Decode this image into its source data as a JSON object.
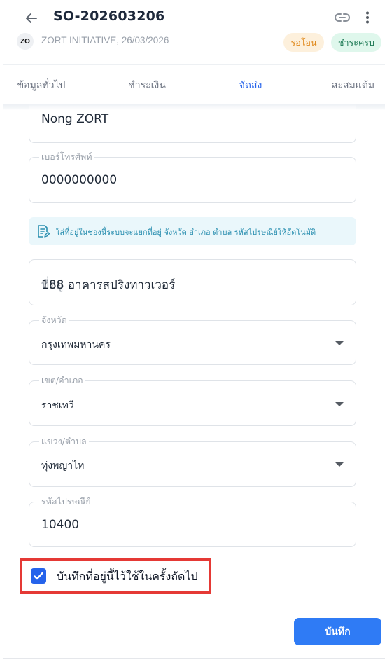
{
  "header": {
    "title": "SO-202603206",
    "avatar_text": "ZO",
    "subtitle": "ZORT INITIATIVE, 26/03/2026",
    "badges": [
      "รอโอน",
      "ชำระครบ"
    ],
    "icons": [
      "back-arrow-icon",
      "link-icon",
      "more-vertical-icon"
    ]
  },
  "tabs": [
    {
      "label": "ข้อมูลทั่วไป"
    },
    {
      "label": "ชำระเงิน"
    },
    {
      "label": "จัดส่ง",
      "active": true
    },
    {
      "label": "สะสมแต้ม"
    }
  ],
  "form": {
    "name_value": "Nong ZORT",
    "phone_label": "เบอร์โทรศัพท์",
    "phone_value": "0000000000",
    "info_text": "ใส่ที่อยู่ในช่องนี้ระบบจะแยกที่อยู่ จังหวัด อำเภอ ตำบล รหัสไปรษณีย์ให้อัตโนมัติ",
    "address_placeholder": "ที่อยู่",
    "address_value": "188 อาคารสปริงทาวเวอร์",
    "province_label": "จังหวัด",
    "province_value": "กรุงเทพมหานคร",
    "district_label": "เขต/อำเภอ",
    "district_value": "ราชเทวี",
    "subdistrict_label": "แขวง/ตำบล",
    "subdistrict_value": "ทุ่งพญาไท",
    "postcode_label": "รหัสไปรษณีย์",
    "postcode_value": "10400"
  },
  "save_address": {
    "label": "บันทึกที่อยู่นี้ไว้ใช้ในครั้งถัดไป",
    "checked": true
  },
  "footer": {
    "save_label": "บันทึก"
  },
  "colors": {
    "accent": "#2f7bf5",
    "highlight": "#e53935",
    "badge_pending_bg": "#fdf0dc",
    "badge_paid_bg": "#dff7ec"
  }
}
